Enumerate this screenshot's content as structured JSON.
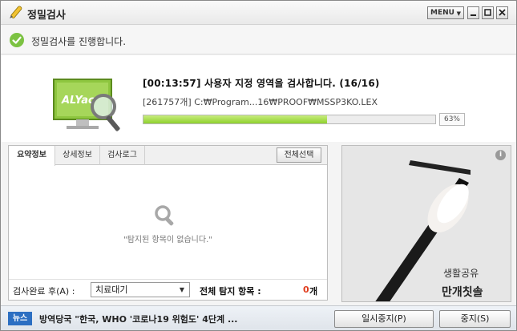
{
  "window": {
    "title": "정밀검사",
    "menu_label": "MENU"
  },
  "status": {
    "text": "정밀검사를 진행합니다."
  },
  "scan": {
    "headline": "[00:13:57]  사용자 지정 영역을 검사합니다. (16/16)",
    "current_path": "[261757개] C:₩Program...16₩PROOF₩MSSP3KO.LEX",
    "progress_percent": 63,
    "progress_label": "63%",
    "monitor_text": "ALYac"
  },
  "tabs": [
    {
      "label": "요약정보"
    },
    {
      "label": "상세정보"
    },
    {
      "label": "검사로그"
    }
  ],
  "panel": {
    "select_all_label": "전체선택",
    "empty_message": "\"탐지된 항목이 없습니다.\"",
    "after_scan_label": "검사완료 후(A) :",
    "after_scan_value": "치료대기",
    "total_label": "전체 탐지 항목 :",
    "total_count": "0",
    "total_unit": "개"
  },
  "ad": {
    "line1": "생활공유",
    "line2": "만개칫솔",
    "info_label": "i"
  },
  "news": {
    "badge": "뉴스",
    "headline": "방역당국 \"한국, WHO '코로나19 위험도' 4단계 ..."
  },
  "buttons": {
    "pause_label": "일시중지(P)",
    "stop_label": "중지(S)"
  },
  "colors": {
    "accent": "#2c6fc2",
    "progress": "#8fd12e",
    "count": "#e03b1c"
  }
}
